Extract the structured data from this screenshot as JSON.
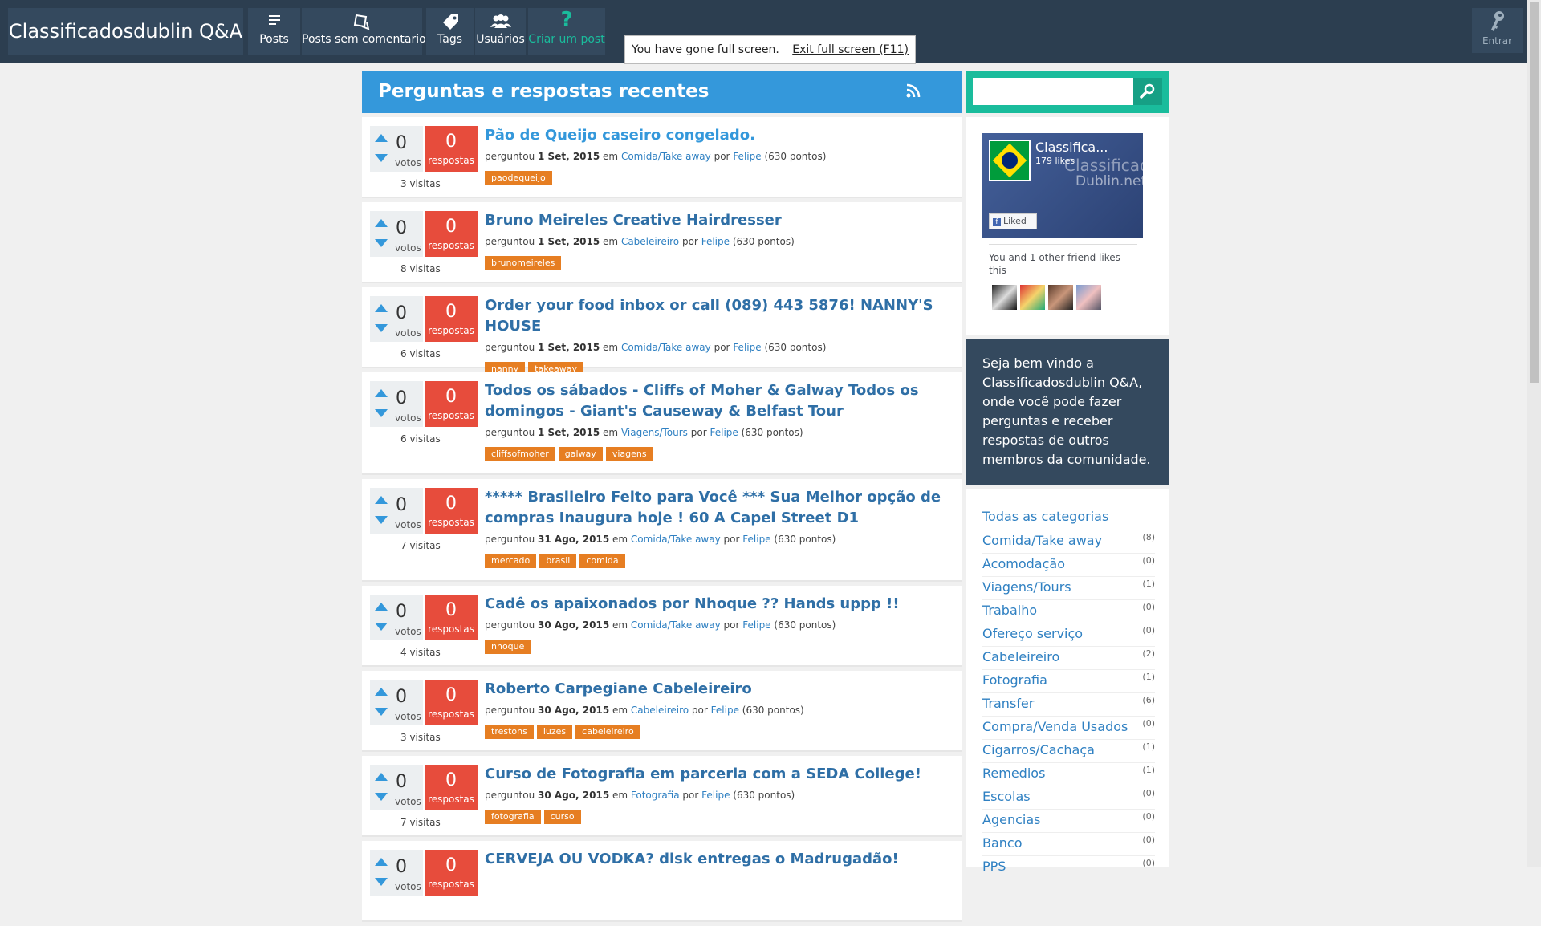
{
  "header": {
    "site_title": "Classificadosdublin Q&A",
    "nav": [
      {
        "label": "Posts",
        "icon": "posts-icon"
      },
      {
        "label": "Posts sem comentarios",
        "icon": "unanswered-icon"
      },
      {
        "label": "Tags",
        "icon": "tags-icon"
      },
      {
        "label": "Usuários",
        "icon": "users-icon"
      },
      {
        "label": "Criar um post",
        "icon": "question-icon"
      }
    ],
    "login_label": "Entrar",
    "fullscreen_message": "You have gone full screen.",
    "fullscreen_exit": "Exit full screen (F11)"
  },
  "main": {
    "title": "Perguntas e respostas recentes",
    "questions": [
      {
        "title": "Pão de Queijo caseiro congelado.",
        "votes": "0",
        "votes_label": "votos",
        "answers": "0",
        "answers_label": "respostas",
        "views": "3 visitas",
        "asked": "perguntou",
        "date": "1 Set, 2015",
        "in": "em",
        "category": "Comida/Take away",
        "by": "por",
        "author": "Felipe",
        "points": "(630 pontos)",
        "tags": [
          "paodequeijo"
        ]
      },
      {
        "title": "Bruno Meireles Creative Hairdresser",
        "votes": "0",
        "votes_label": "votos",
        "answers": "0",
        "answers_label": "respostas",
        "views": "8 visitas",
        "asked": "perguntou",
        "date": "1 Set, 2015",
        "in": "em",
        "category": "Cabeleireiro",
        "by": "por",
        "author": "Felipe",
        "points": "(630 pontos)",
        "tags": [
          "brunomeireles"
        ]
      },
      {
        "title": "Order your food inbox or call (089) 443 5876! NANNY'S HOUSE",
        "votes": "0",
        "votes_label": "votos",
        "answers": "0",
        "answers_label": "respostas",
        "views": "6 visitas",
        "asked": "perguntou",
        "date": "1 Set, 2015",
        "in": "em",
        "category": "Comida/Take away",
        "by": "por",
        "author": "Felipe",
        "points": "(630 pontos)",
        "tags": [
          "nanny",
          "takeaway"
        ]
      },
      {
        "title": "Todos os sábados - Cliffs of Moher & Galway Todos os domingos - Giant's Causeway & Belfast Tour",
        "votes": "0",
        "votes_label": "votos",
        "answers": "0",
        "answers_label": "respostas",
        "views": "6 visitas",
        "asked": "perguntou",
        "date": "1 Set, 2015",
        "in": "em",
        "category": "Viagens/Tours",
        "by": "por",
        "author": "Felipe",
        "points": "(630 pontos)",
        "tags": [
          "cliffsofmoher",
          "galway",
          "viagens"
        ]
      },
      {
        "title": "***** Brasileiro Feito para Você *** Sua Melhor opção de compras Inaugura hoje ! 60 A Capel Street D1",
        "votes": "0",
        "votes_label": "votos",
        "answers": "0",
        "answers_label": "respostas",
        "views": "7 visitas",
        "asked": "perguntou",
        "date": "31 Ago, 2015",
        "in": "em",
        "category": "Comida/Take away",
        "by": "por",
        "author": "Felipe",
        "points": "(630 pontos)",
        "tags": [
          "mercado",
          "brasil",
          "comida"
        ]
      },
      {
        "title": "Cadê os apaixonados por Nhoque ?? Hands uppp !!",
        "votes": "0",
        "votes_label": "votos",
        "answers": "0",
        "answers_label": "respostas",
        "views": "4 visitas",
        "asked": "perguntou",
        "date": "30 Ago, 2015",
        "in": "em",
        "category": "Comida/Take away",
        "by": "por",
        "author": "Felipe",
        "points": "(630 pontos)",
        "tags": [
          "nhoque"
        ]
      },
      {
        "title": "Roberto Carpegiane Cabeleireiro",
        "votes": "0",
        "votes_label": "votos",
        "answers": "0",
        "answers_label": "respostas",
        "views": "3 visitas",
        "asked": "perguntou",
        "date": "30 Ago, 2015",
        "in": "em",
        "category": "Cabeleireiro",
        "by": "por",
        "author": "Felipe",
        "points": "(630 pontos)",
        "tags": [
          "trestons",
          "luzes",
          "cabeleireiro"
        ]
      },
      {
        "title": "Curso de Fotografia em parceria com a SEDA College!",
        "votes": "0",
        "votes_label": "votos",
        "answers": "0",
        "answers_label": "respostas",
        "views": "7 visitas",
        "asked": "perguntou",
        "date": "30 Ago, 2015",
        "in": "em",
        "category": "Fotografia",
        "by": "por",
        "author": "Felipe",
        "points": "(630 pontos)",
        "tags": [
          "fotografia",
          "curso"
        ]
      },
      {
        "title": "CERVEJA OU VODKA? disk entregas o Madrugadão!",
        "votes": "0",
        "votes_label": "votos",
        "answers": "0",
        "answers_label": "respostas",
        "views": "",
        "asked": "",
        "date": "",
        "in": "",
        "category": "",
        "by": "",
        "author": "",
        "points": "",
        "tags": []
      }
    ]
  },
  "sidebar": {
    "search": {
      "placeholder": "",
      "value": ""
    },
    "facebook": {
      "page_name": "Classifica...",
      "likes": "179 likes",
      "watermark_line1": "Classificados",
      "watermark_line2": "Dublin.net",
      "liked_label": "Liked",
      "friends_text": "You and 1 other friend likes this"
    },
    "welcome_text": "Seja bem vindo a Classificadosdublin Q&A, onde você pode fazer perguntas e receber respostas de outros membros da comunidade.",
    "all_categories": "Todas as categorias",
    "categories": [
      {
        "name": "Comida/Take away",
        "count": "(8)"
      },
      {
        "name": "Acomodação",
        "count": "(0)"
      },
      {
        "name": "Viagens/Tours",
        "count": "(1)"
      },
      {
        "name": "Trabalho",
        "count": "(0)"
      },
      {
        "name": "Ofereço serviço",
        "count": "(0)"
      },
      {
        "name": "Cabeleireiro",
        "count": "(2)"
      },
      {
        "name": "Fotografia",
        "count": "(1)"
      },
      {
        "name": "Transfer",
        "count": "(6)"
      },
      {
        "name": "Compra/Venda Usados",
        "count": "(0)"
      },
      {
        "name": "Cigarros/Cachaça",
        "count": "(1)"
      },
      {
        "name": "Remedios",
        "count": "(1)"
      },
      {
        "name": "Escolas",
        "count": "(0)"
      },
      {
        "name": "Agencias",
        "count": "(0)"
      },
      {
        "name": "Banco",
        "count": "(0)"
      },
      {
        "name": "PPS",
        "count": "(0)"
      }
    ]
  },
  "colors": {
    "header_bg": "#2c3e50",
    "nav_bg": "#34495e",
    "accent_blue": "#3498db",
    "answers_red": "#e74c3c",
    "tag_orange": "#e67e22",
    "search_teal": "#1abc9c"
  }
}
